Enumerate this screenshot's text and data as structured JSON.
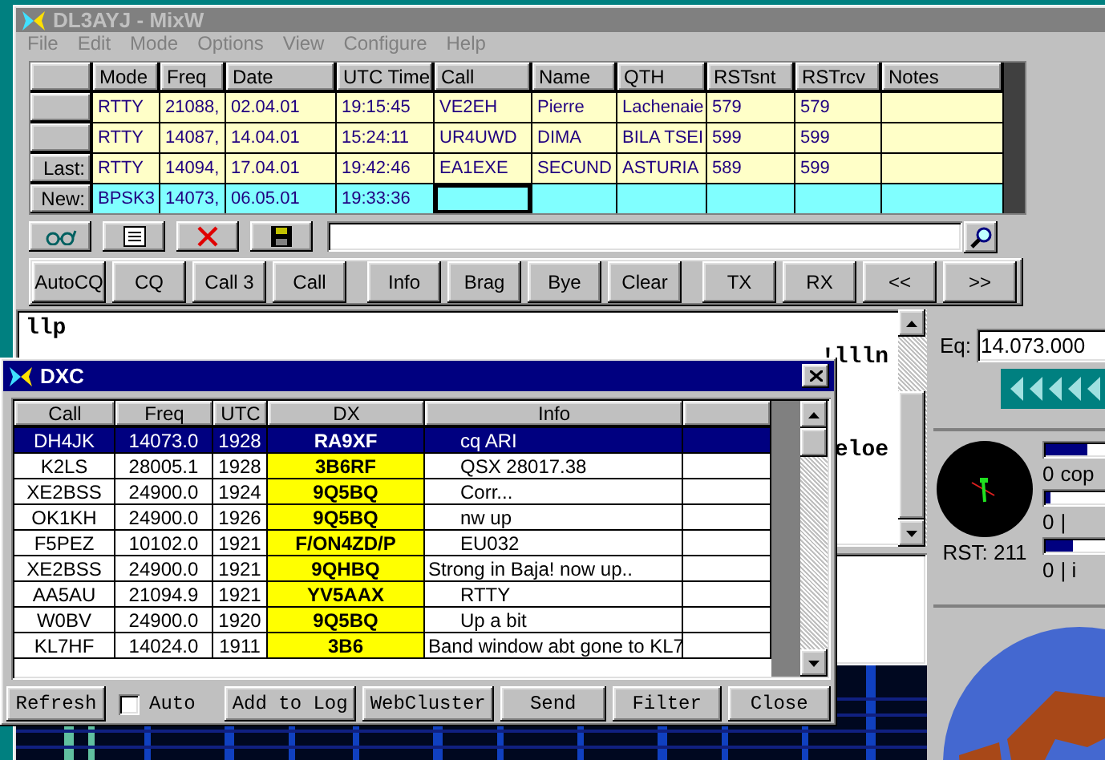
{
  "main_window": {
    "title": "DL3AYJ - MixW",
    "menu": [
      "File",
      "Edit",
      "Mode",
      "Options",
      "View",
      "Configure",
      "Help"
    ]
  },
  "log": {
    "columns": [
      "Mode",
      "Freq",
      "Date",
      "UTC Time",
      "Call",
      "Name",
      "QTH",
      "RSTsnt",
      "RSTrcv",
      "Notes"
    ],
    "rows": [
      {
        "kind": "logged",
        "mode": "RTTY",
        "freq": "21088,",
        "date": "02.04.01",
        "utc": "19:15:45",
        "call": "VE2EH",
        "name": "Pierre",
        "qth": "Lachenaie",
        "rst_snt": "579",
        "rst_rcv": "579"
      },
      {
        "kind": "logged",
        "mode": "RTTY",
        "freq": "14087,",
        "date": "14.04.01",
        "utc": "15:24:11",
        "call": "UR4UWD",
        "name": "DIMA",
        "qth": "BILA TSEI",
        "rst_snt": "599",
        "rst_rcv": "599"
      },
      {
        "kind": "logged",
        "header": "Last:",
        "mode": "RTTY",
        "freq": "14094,",
        "date": "17.04.01",
        "utc": "19:42:46",
        "call": "EA1EXE",
        "name": "SECUND",
        "qth": "ASTURIA",
        "rst_snt": "589",
        "rst_rcv": "599"
      },
      {
        "kind": "new",
        "header": "New:",
        "mode": "BPSK3",
        "freq": "14073,",
        "date": "06.05.01",
        "utc": "19:33:36",
        "call_focused": true
      }
    ]
  },
  "macro_buttons": [
    "AutoCQ",
    "CQ",
    "Call 3",
    "Call",
    "Info",
    "Brag",
    "Bye",
    "Clear",
    "TX",
    "RX",
    "<<",
    ">>"
  ],
  "receive_text": [
    {
      "text": "llp",
      "kind": "start"
    },
    {
      "text": "!llln",
      "kind": "end"
    },
    {
      "text": "eloe",
      "kind": "end"
    }
  ],
  "frequency": {
    "label": "Eq:",
    "value": "14.073.000"
  },
  "tuning": {
    "rst": "RST: 211",
    "meters": [
      {
        "level": 0.4,
        "value": "0",
        "label": "cop"
      },
      {
        "level": 0.05,
        "value": "0",
        "label": "|"
      },
      {
        "level": 0.25,
        "value": "0",
        "label": "| i"
      }
    ]
  },
  "dxc": {
    "title": "DXC",
    "columns": [
      "Call",
      "Freq",
      "UTC",
      "DX",
      "Info"
    ],
    "rows": [
      {
        "call": "DH4JK",
        "freq": "14073.0",
        "utc": "1928",
        "dx": "RA9XF",
        "info": "cq ARI",
        "selected": true
      },
      {
        "call": "K2LS",
        "freq": "28005.1",
        "utc": "1928",
        "dx": "3B6RF",
        "info": "QSX 28017.38",
        "selected": false
      },
      {
        "call": "XE2BSS",
        "freq": "24900.0",
        "utc": "1924",
        "dx": "9Q5BQ",
        "info": "Corr...",
        "selected": false
      },
      {
        "call": "OK1KH",
        "freq": "24900.0",
        "utc": "1926",
        "dx": "9Q5BQ",
        "info": "nw up",
        "selected": false
      },
      {
        "call": "F5PEZ",
        "freq": "10102.0",
        "utc": "1921",
        "dx": "F/ON4ZD/P",
        "info": "EU032",
        "selected": false
      },
      {
        "call": "XE2BSS",
        "freq": "24900.0",
        "utc": "1921",
        "dx": "9QHBQ",
        "info": "Strong in Baja! now up..",
        "selected": false
      },
      {
        "call": "AA5AU",
        "freq": "21094.9",
        "utc": "1921",
        "dx": "YV5AAX",
        "info": "RTTY",
        "selected": false
      },
      {
        "call": "W0BV",
        "freq": "24900.0",
        "utc": "1920",
        "dx": "9Q5BQ",
        "info": "Up a bit",
        "selected": false
      },
      {
        "call": "KL7HF",
        "freq": "14024.0",
        "utc": "1911",
        "dx": "3B6",
        "info": "Band window abt gone to KL7",
        "selected": false
      }
    ],
    "auto": {
      "label": "Auto",
      "checked": false
    },
    "buttons": [
      "Refresh",
      "Add to Log",
      "WebCluster",
      "Send",
      "Filter",
      "Close"
    ]
  }
}
